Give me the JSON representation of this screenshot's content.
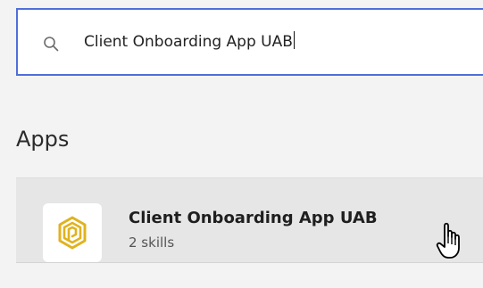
{
  "search": {
    "query": "Client Onboarding App UAB",
    "icon": "search-icon",
    "border_color": "#4f6fd9"
  },
  "section": {
    "heading": "Apps"
  },
  "apps": [
    {
      "name": "Client Onboarding App UAB",
      "meta": "2 skills",
      "icon": "hexagon-spiral-logo-icon",
      "accent_color": "#e0b21f"
    }
  ],
  "cursor": {
    "icon": "pointer-hand-cursor-icon"
  }
}
